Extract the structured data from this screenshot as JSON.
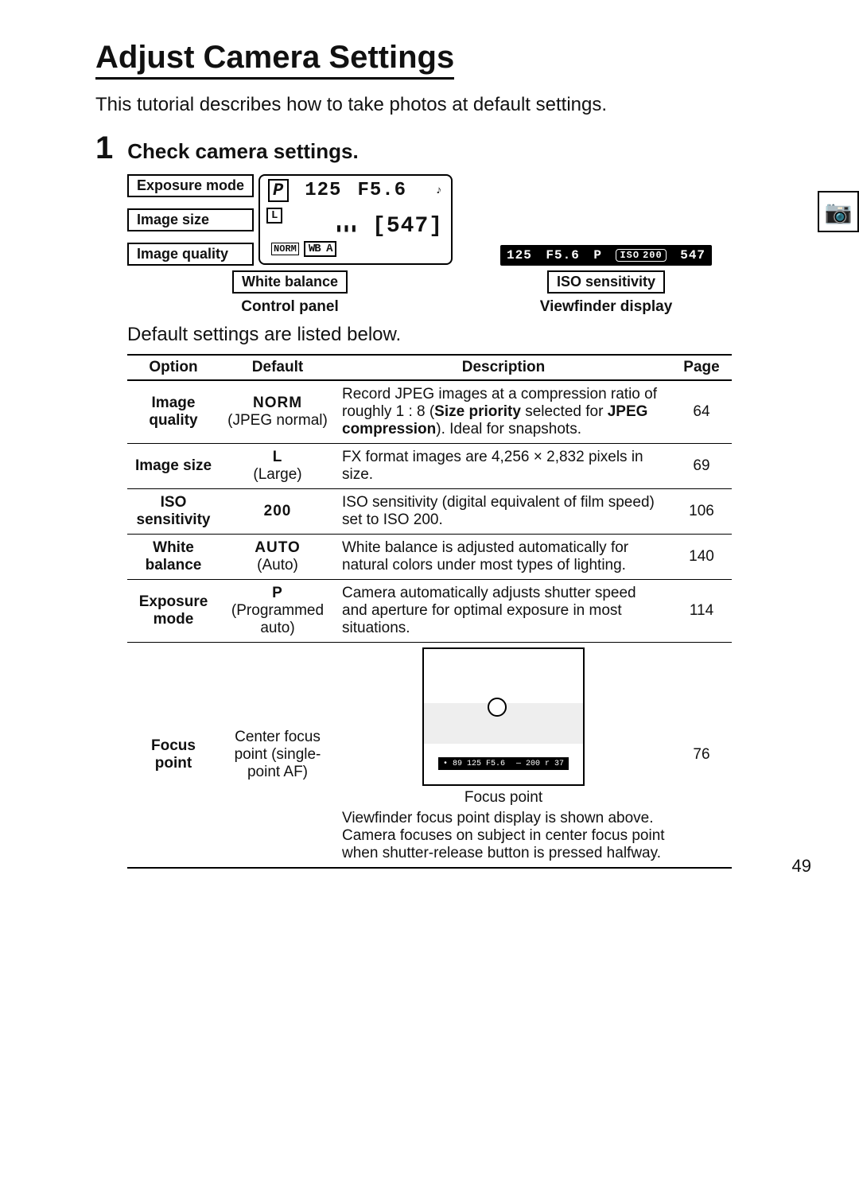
{
  "title": "Adjust Camera Settings",
  "intro": "This tutorial describes how to take photos at default settings.",
  "step": {
    "num": "1",
    "title": "Check camera settings."
  },
  "callouts": {
    "exposure": "Exposure mode",
    "size": "Image size",
    "quality": "Image quality",
    "wb": "White balance",
    "iso": "ISO sensitivity"
  },
  "control_panel": {
    "mode": "P",
    "shutter": "125",
    "aperture": "F5.6",
    "size": "L",
    "quality": "NORM",
    "wb": "WB A",
    "frames": "[547]",
    "caption": "Control panel"
  },
  "viewfinder": {
    "shutter": "125",
    "aperture": "F5.6",
    "mode": "P",
    "iso_label": "ISO",
    "iso_value": "200",
    "frames": "547",
    "caption": "Viewfinder display"
  },
  "subtext": "Default settings are listed below.",
  "table": {
    "headers": {
      "option": "Option",
      "default": "Default",
      "description": "Description",
      "page": "Page"
    },
    "rows": [
      {
        "option": "Image quality",
        "default_strong": "NORM",
        "default_sub": "(JPEG normal)",
        "desc_html": "Record JPEG images at a compression ratio of roughly 1 : 8 (<b>Size priority</b> selected for <b>JPEG compression</b>).  Ideal for snapshots.",
        "page": "64"
      },
      {
        "option": "Image size",
        "default_strong": "L",
        "default_sub": "(Large)",
        "desc_html": "FX format images are 4,256 × 2,832 pixels in size.",
        "page": "69"
      },
      {
        "option": "ISO sensitivity",
        "default_strong": "200",
        "default_sub": "",
        "desc_html": "ISO sensitivity (digital equivalent of film speed) set to ISO 200.",
        "page": "106"
      },
      {
        "option": "White balance",
        "default_strong": "AUTO",
        "default_sub": "(Auto)",
        "desc_html": "White balance is adjusted automatically for natural colors under most types of lighting.",
        "page": "140"
      },
      {
        "option": "Exposure mode",
        "default_strong": "P",
        "default_sub": "(Programmed auto)",
        "desc_html": "Camera automatically adjusts shutter speed and aperture for optimal exposure in most situations.",
        "page": "114"
      }
    ],
    "focus_row": {
      "option": "Focus point",
      "default": "Center focus point (single-point AF)",
      "ill_caption": "Focus point",
      "ill_strip_left": "• 89  125  F5.6",
      "ill_strip_right": "— 200 r 37",
      "desc": "Viewfinder focus point display is shown above.  Camera focuses on subject in center focus point when shutter-release button is pressed halfway.",
      "page": "76"
    }
  },
  "pagenum": "49"
}
